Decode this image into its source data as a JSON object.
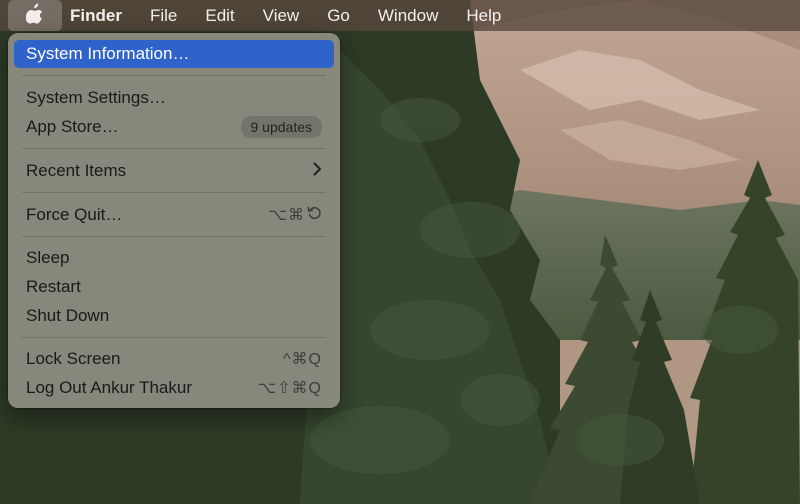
{
  "menubar": {
    "apple_icon": "apple-logo-icon",
    "items": [
      "Finder",
      "File",
      "Edit",
      "View",
      "Go",
      "Window",
      "Help"
    ]
  },
  "apple_menu": {
    "system_information": "System Information…",
    "system_settings": "System Settings…",
    "app_store": "App Store…",
    "app_store_badge": "9 updates",
    "recent_items": "Recent Items",
    "force_quit": "Force Quit…",
    "force_quit_shortcut": "⌥⌘",
    "sleep": "Sleep",
    "restart": "Restart",
    "shut_down": "Shut Down",
    "lock_screen": "Lock Screen",
    "lock_screen_shortcut": "^⌘Q",
    "log_out": "Log Out Ankur Thakur",
    "log_out_shortcut": "⌥⇧⌘Q"
  },
  "colors": {
    "selection": "#2f63c9",
    "menu_background": "#949288"
  }
}
